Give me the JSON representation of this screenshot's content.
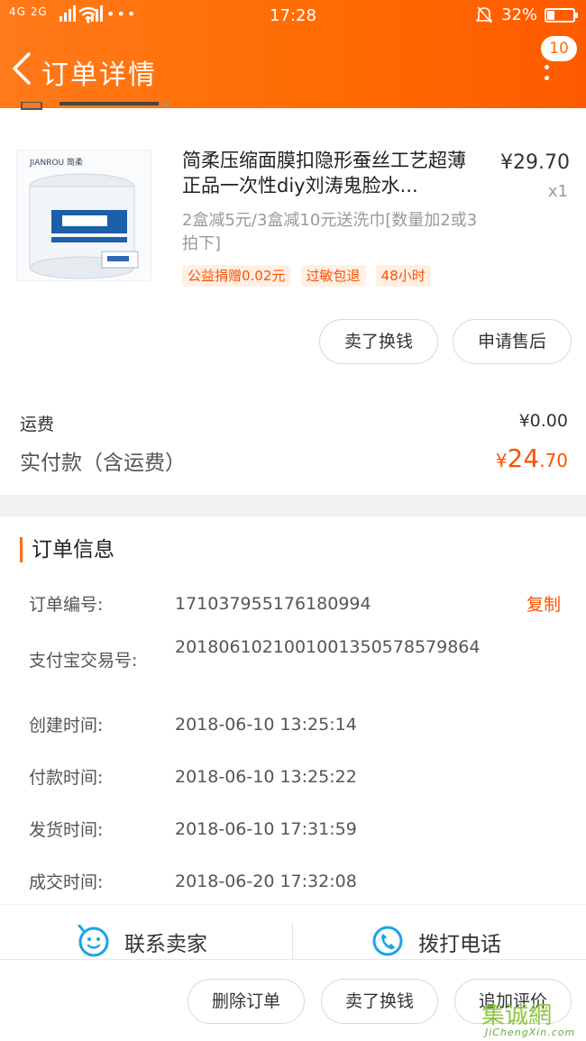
{
  "status_bar": {
    "signal": "4G  2G",
    "time": "17:28",
    "battery": "32%"
  },
  "header": {
    "title": "订单详情",
    "badge_count": "10"
  },
  "product": {
    "brand": "JIANROU 简柔",
    "title": "简柔压缩面膜扣隐形蚕丝工艺超薄正品一次性diy刘涛鬼脸水...",
    "price": "¥29.70",
    "quantity": "x1",
    "sku": "2盒减5元/3盒减10元送洗巾[数量加2或3拍下]",
    "tags": [
      "公益捐赠0.02元",
      "过敏包退",
      "48小时"
    ],
    "buttons": {
      "sell_label": "卖了换钱",
      "after_sale_label": "申请售后"
    }
  },
  "fees": {
    "shipping_label": "运费",
    "shipping_value": "¥0.00",
    "paid_label": "实付款（含运费）",
    "paid_currency": "¥",
    "paid_integer": "24",
    "paid_decimal": ".70"
  },
  "order_info": {
    "title": "订单信息",
    "copy_label": "复制",
    "rows": [
      {
        "label": "订单编号:",
        "value": "171037955176180994"
      },
      {
        "label": "支付宝交易号:",
        "value": "2018061021001001350578579864"
      },
      {
        "label": "创建时间:",
        "value": "2018-06-10 13:25:14"
      },
      {
        "label": "付款时间:",
        "value": "2018-06-10 13:25:22"
      },
      {
        "label": "发货时间:",
        "value": "2018-06-10 17:31:59"
      },
      {
        "label": "成交时间:",
        "value": "2018-06-20 17:32:08"
      }
    ]
  },
  "contact": {
    "seller_label": "联系卖家",
    "phone_label": "拨打电话"
  },
  "bottom_actions": {
    "delete_label": "删除订单",
    "sell_label": "卖了换钱",
    "review_label": "追加评价"
  },
  "watermark": {
    "cn": "集诚網",
    "en": "JiChengXin.com"
  },
  "colors": {
    "brand": "#ff6a00",
    "price_accent": "#ff5000",
    "tag_bg": "#fff0e6"
  }
}
